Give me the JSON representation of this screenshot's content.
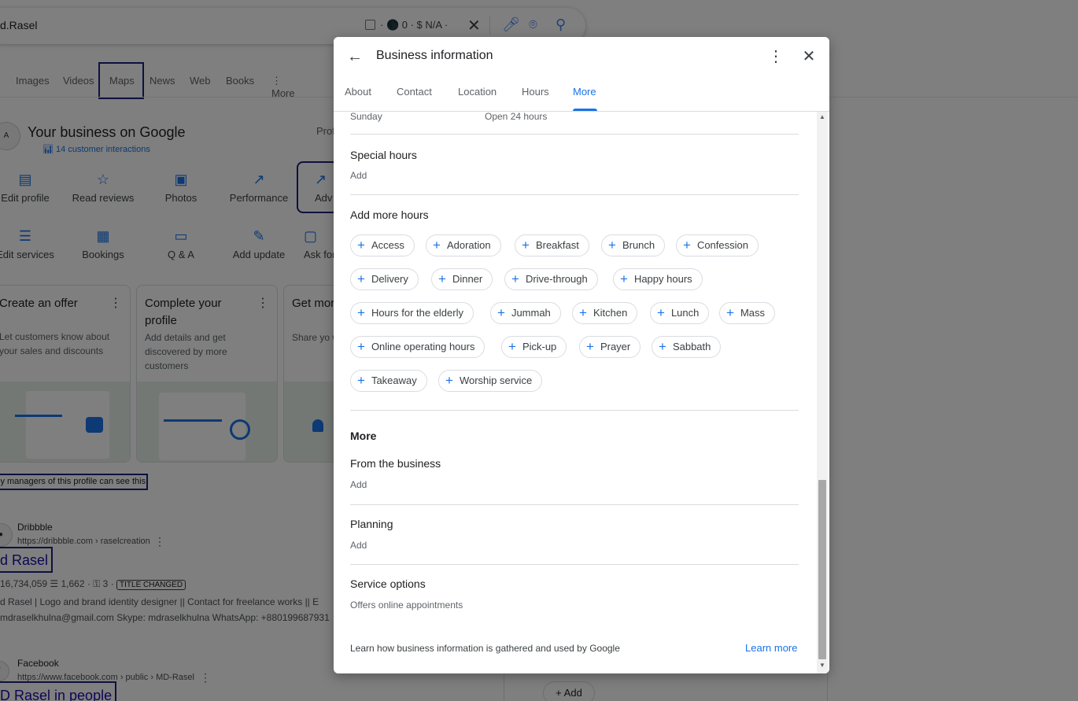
{
  "background": {
    "search_query": "d.Rasel",
    "extension_text": "· 🌑 0 · $ N/A ·",
    "tabs": [
      {
        "label": "Images"
      },
      {
        "label": "Videos"
      },
      {
        "label": "Maps"
      },
      {
        "label": "News"
      },
      {
        "label": "Web"
      },
      {
        "label": "Books"
      },
      {
        "label": "⋮ More"
      }
    ],
    "business": {
      "title": "Your business on Google",
      "interactions": "14 customer interactions",
      "profile_label": "Prof",
      "avatar_text": "A",
      "actions_row1": [
        "Edit profile",
        "Read reviews",
        "Photos",
        "Performance",
        "Adv"
      ],
      "actions_row2": [
        "Edit services",
        "Bookings",
        "Q & A",
        "Add update",
        "Ask for"
      ]
    },
    "cards": [
      {
        "title": "Create an offer",
        "desc": "Let customers know about your sales and discounts"
      },
      {
        "title": "Complete your profile",
        "desc": "Add details and get discovered by more customers"
      },
      {
        "title": "Get mor",
        "desc": "Share yo with past"
      }
    ],
    "managers_note": "ly managers of this profile can see this",
    "results": [
      {
        "site": "Dribbble",
        "url": "https://dribbble.com › raselcreation",
        "title": "d Rasel",
        "stats": "16,734,059",
        "stats2": "1,662",
        "stats3": "3",
        "tag": "TITLE CHANGED",
        "snippet1": "d Rasel | Logo and brand identity designer || Contact for freelance works || E",
        "snippet2": "mdraselkhulna@gmail.com Skype: mdraselkhulna WhatsApp: +880199687931"
      },
      {
        "site": "Facebook",
        "url": "https://www.facebook.com › public › MD-Rasel",
        "title": "D Rasel in people"
      }
    ],
    "right_add_label": "Add"
  },
  "dialog": {
    "title": "Business information",
    "tabs": [
      {
        "label": "About",
        "active": false
      },
      {
        "label": "Contact",
        "active": false
      },
      {
        "label": "Location",
        "active": false
      },
      {
        "label": "Hours",
        "active": false
      },
      {
        "label": "More",
        "active": true
      }
    ],
    "sunday_row": {
      "day": "Sunday",
      "hours": "Open 24 hours"
    },
    "special_hours": {
      "title": "Special hours",
      "action": "Add"
    },
    "more_hours": {
      "title": "Add more hours",
      "chips": [
        "Access",
        "Adoration",
        "Breakfast",
        "Brunch",
        "Confession",
        "Delivery",
        "Dinner",
        "Drive-through",
        "Happy hours",
        "Hours for the elderly",
        "Jummah",
        "Kitchen",
        "Lunch",
        "Mass",
        "Online operating hours",
        "Pick-up",
        "Prayer",
        "Sabbath",
        "Takeaway",
        "Worship service"
      ]
    },
    "more_section": {
      "title": "More",
      "from_business": {
        "title": "From the business",
        "action": "Add"
      },
      "planning": {
        "title": "Planning",
        "action": "Add"
      },
      "service_options": {
        "title": "Service options",
        "value": "Offers online appointments"
      }
    },
    "footer": {
      "text": "Learn how business information is gathered and used by Google",
      "link": "Learn more"
    },
    "colors": {
      "accent": "#1a73e8",
      "overlay": "rgba(0,0,0,0.5)"
    }
  }
}
